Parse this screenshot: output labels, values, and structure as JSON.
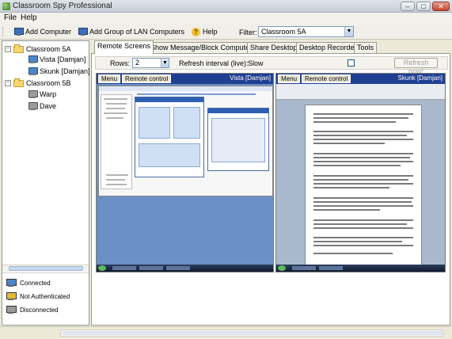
{
  "window": {
    "title": "Classroom Spy Professional"
  },
  "menu": {
    "file": "File",
    "help": "Help"
  },
  "toolbar": {
    "add_computer": "Add Computer",
    "add_group": "Add Group of LAN Computers",
    "help": "Help",
    "filter_label": "Filter:",
    "filter_value": "Classroom 5A"
  },
  "tree": {
    "groups": [
      {
        "label": "Classroom 5A",
        "computers": [
          "Vista [Damjan]",
          "Skunk [Damjan]"
        ]
      },
      {
        "label": "Classroom 5B",
        "computers": [
          "Warp",
          "Dave"
        ]
      }
    ]
  },
  "legend": {
    "connected": "Connected",
    "not_authenticated": "Not Authenticated",
    "disconnected": "Disconnected"
  },
  "tabs": [
    "Remote Screens",
    "Show Message/Block Computers",
    "Share Desktop",
    "Desktop Recorder",
    "Tools"
  ],
  "options": {
    "rows_label": "Rows:",
    "rows_value": "2",
    "refresh_label": "Refresh interval (live):",
    "refresh_value": "Slow",
    "refresh_now": "Refresh now!"
  },
  "screens": [
    {
      "menu": "Menu",
      "remote": "Remote control",
      "name": "Vista [Damjan]"
    },
    {
      "menu": "Menu",
      "remote": "Remote control",
      "name": "Skunk [Damjan]"
    }
  ],
  "colors": {
    "screen_header": "#1f3f92",
    "folder": "#f7d774",
    "connected": "#4a86c8"
  }
}
